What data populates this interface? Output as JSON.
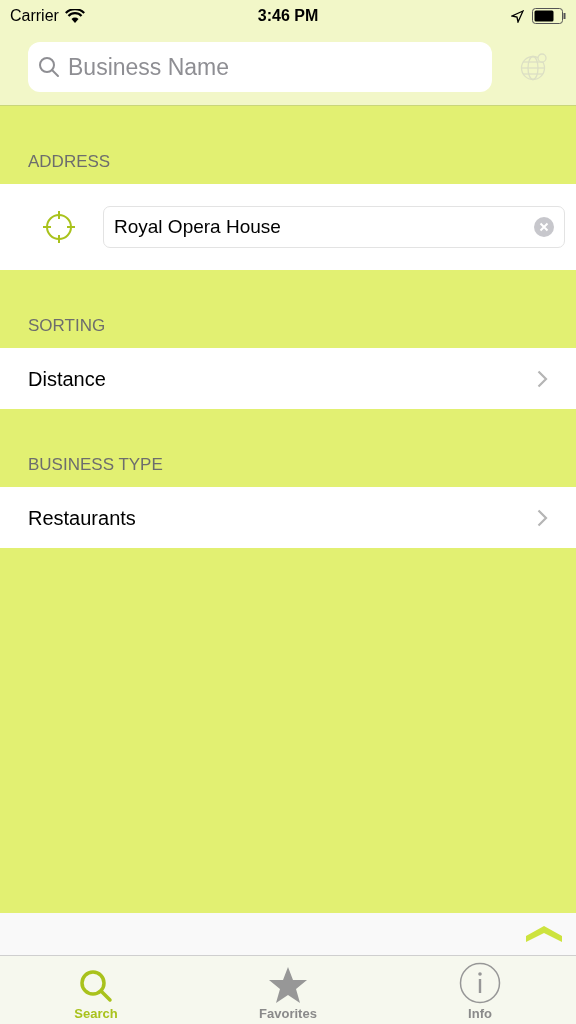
{
  "status_bar": {
    "carrier": "Carrier",
    "time": "3:46 PM"
  },
  "search": {
    "placeholder": "Business Name"
  },
  "sections": [
    {
      "header": "ADDRESS",
      "kind": "field",
      "value": "Royal Opera House"
    },
    {
      "header": "SORTING",
      "kind": "disclosure",
      "value": "Distance"
    },
    {
      "header": "BUSINESS TYPE",
      "kind": "disclosure",
      "value": "Restaurants"
    }
  ],
  "tabs": [
    {
      "label": "Search",
      "kind": "search",
      "selected": true
    },
    {
      "label": "Favorites",
      "kind": "star",
      "selected": false
    },
    {
      "label": "Info",
      "kind": "info",
      "selected": false
    }
  ]
}
